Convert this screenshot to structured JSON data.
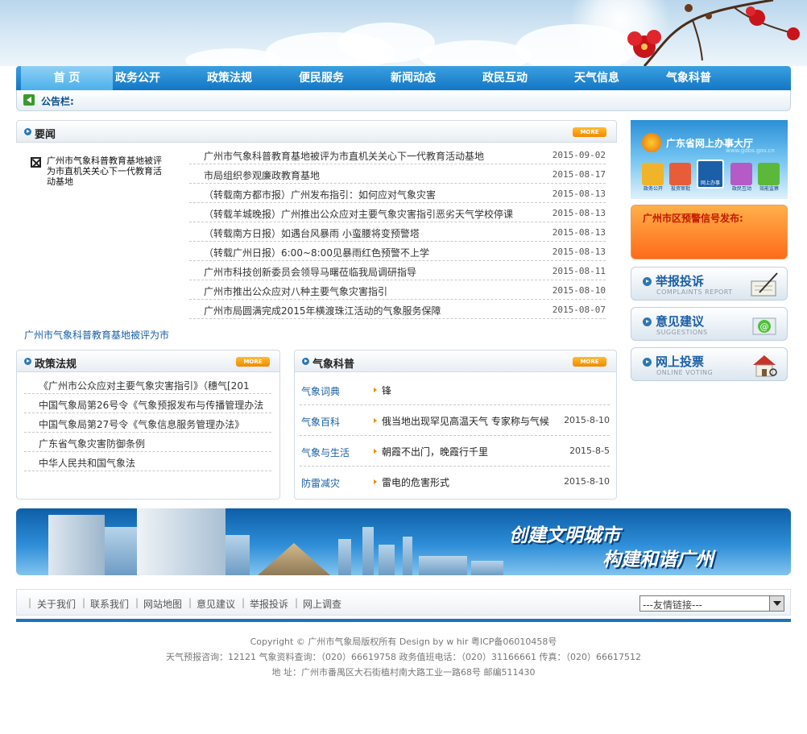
{
  "nav": {
    "items": [
      "首 页",
      "政务公开",
      "政策法规",
      "便民服务",
      "新闻动态",
      "政民互动",
      "天气信息",
      "气象科普"
    ]
  },
  "notice": {
    "label": "公告栏:"
  },
  "news": {
    "title": "要闻",
    "more": "MORE",
    "feature": "广州市气象科普教育基地被评为市直机关关心下一代教育活动基地",
    "items": [
      {
        "title": "广州市气象科普教育基地被评为市直机关关心下一代教育活动基地",
        "date": "2015-09-02"
      },
      {
        "title": "市局组织参观廉政教育基地",
        "date": "2015-08-17"
      },
      {
        "title": "（转载南方都市报）广州发布指引：如何应对气象灾害",
        "date": "2015-08-13"
      },
      {
        "title": "（转载羊城晚报）广州推出公众应对主要气象灾害指引恶劣天气学校停课",
        "date": "2015-08-13"
      },
      {
        "title": "（转载南方日报）如遇台风暴雨 小蛮腰将变预警塔",
        "date": "2015-08-13"
      },
      {
        "title": "（转载广州日报）6:00~8:00见暴雨红色预警不上学",
        "date": "2015-08-13"
      },
      {
        "title": "广州市科技创新委员会领导马曙莅临我局调研指导",
        "date": "2015-08-11"
      },
      {
        "title": "广州市推出公众应对八种主要气象灾害指引",
        "date": "2015-08-10"
      },
      {
        "title": "广州市局圆满完成2015年横渡珠江活动的气象服务保障",
        "date": "2015-08-07"
      }
    ],
    "marquee": "广州市气象科普教育基地被评为市"
  },
  "policy": {
    "title": "政策法规",
    "more": "MORE",
    "items": [
      "《广州市公众应对主要气象灾害指引》（穗气[201",
      "中国气象局第26号令《气象预报发布与传播管理办法",
      "中国气象局第27号令《气象信息服务管理办法》",
      "广东省气象灾害防御条例",
      "中华人民共和国气象法"
    ]
  },
  "science": {
    "title": "气象科普",
    "more": "MORE",
    "items": [
      {
        "category": "气象词典",
        "title": "锋",
        "date": ""
      },
      {
        "category": "气象百科",
        "title": "俄当地出现罕见高温天气 专家称与气候",
        "date": "2015-8-10"
      },
      {
        "category": "气象与生活",
        "title": "朝霞不出门，晚霞行千里",
        "date": "2015-8-5"
      },
      {
        "category": "防雷减灾",
        "title": "雷电的危害形式",
        "date": "2015-8-10"
      }
    ]
  },
  "sidebar": {
    "hall": {
      "title": "广东省网上办事大厅",
      "url": "www.gdbs.gov.cn",
      "icons": [
        "政务公开",
        "投资审批",
        "网上办事",
        "政民互动",
        "效能监察"
      ]
    },
    "warning": {
      "title": "广州市区预警信号发布:"
    },
    "actions": [
      {
        "title": "举报投诉",
        "subtitle": "COMPLAINTS REPORT"
      },
      {
        "title": "意见建议",
        "subtitle": "SUGGESTIONS"
      },
      {
        "title": "网上投票",
        "subtitle": "ONLINE VOTING"
      }
    ]
  },
  "banner": {
    "line1": "创建文明城市",
    "line2": "构建和谐广州"
  },
  "footer": {
    "links": [
      "关于我们",
      "联系我们",
      "网站地图",
      "意见建议",
      "举报投诉",
      "网上调查"
    ],
    "friend_links": "---友情链接---",
    "copyright": "Copyright © 广州市气象局版权所有 Design by w hir 粤ICP备06010458号",
    "contact": "天气预报咨询：12121 气象资料查询：（020）66619758 政务值班电话：（020）31166661 传真：（020）66617512",
    "address": "地 址：广州市番禺区大石街植村南大路工业一路68号 邮编511430"
  },
  "colors": {
    "nav_blue": "#1376c5",
    "link_blue": "#1b5fa5",
    "more_orange": "#f08a00",
    "warning_orange": "#ff6a1a",
    "footer_bar": "#1a73bd"
  }
}
